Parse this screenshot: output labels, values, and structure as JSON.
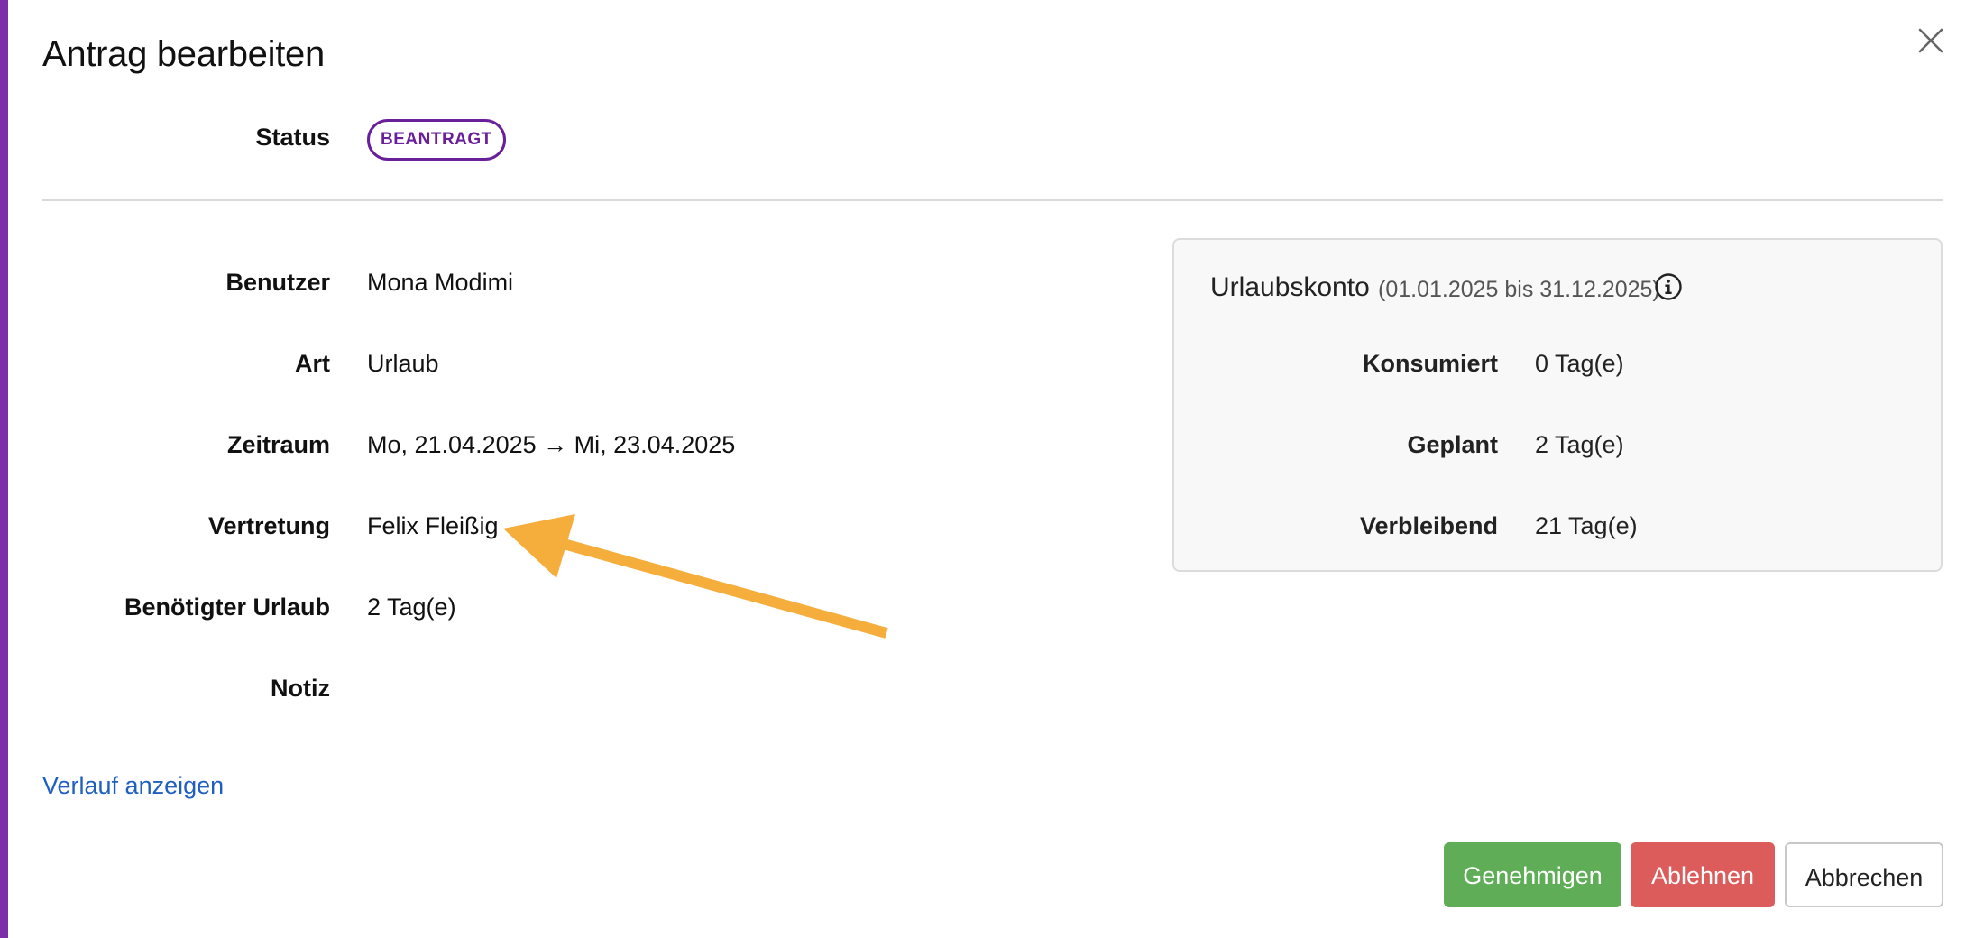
{
  "dialog": {
    "title": "Antrag bearbeiten",
    "close_icon": "close-icon"
  },
  "status": {
    "label": "Status",
    "badge": "BEANTRAGT",
    "badge_color": "#6a1f9a"
  },
  "fields": {
    "user": {
      "label": "Benutzer",
      "value": "Mona Modimi"
    },
    "type": {
      "label": "Art",
      "value": "Urlaub"
    },
    "period": {
      "label": "Zeitraum",
      "value": "Mo, 21.04.2025 → Mi, 23.04.2025"
    },
    "substitute": {
      "label": "Vertretung",
      "value": "Felix Fleißig"
    },
    "required": {
      "label": "Benötigter Urlaub",
      "value": "2 Tag(e)"
    },
    "note": {
      "label": "Notiz",
      "value": ""
    }
  },
  "account": {
    "heading": "Urlaubskonto",
    "range": "(01.01.2025 bis 31.12.2025)",
    "info_icon": "info-icon",
    "rows": {
      "consumed": {
        "label": "Konsumiert",
        "value": "0 Tag(e)"
      },
      "planned": {
        "label": "Geplant",
        "value": "2 Tag(e)"
      },
      "remaining": {
        "label": "Verbleibend",
        "value": "21 Tag(e)"
      }
    }
  },
  "history_link": "Verlauf anzeigen",
  "actions": {
    "approve": "Genehmigen",
    "reject": "Ablehnen",
    "cancel": "Abbrechen"
  },
  "colors": {
    "accent_bar": "#7b2fa8",
    "approve": "#5fad56",
    "reject": "#dc5b5b",
    "link": "#1f5fbf",
    "annotation_arrow": "#f5ad3c"
  }
}
